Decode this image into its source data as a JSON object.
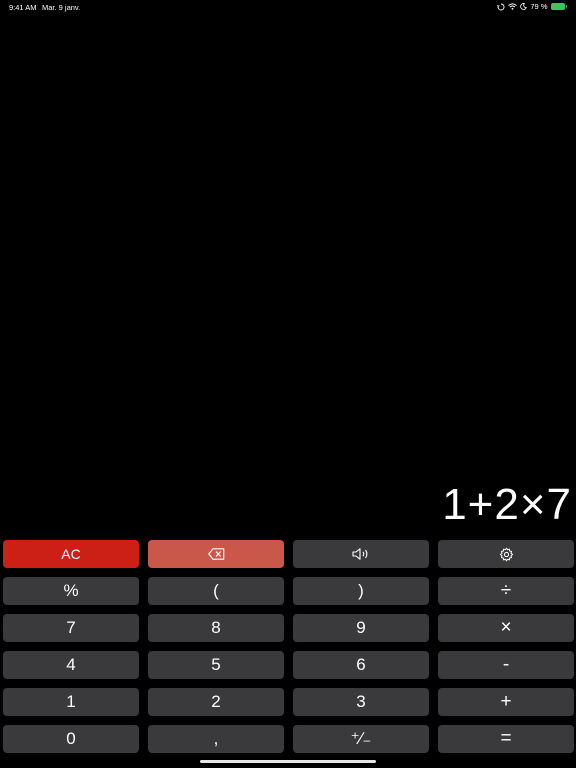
{
  "status_bar": {
    "time": "9:41 AM",
    "date": "Mar. 9 janv.",
    "battery_percent": "79 %",
    "battery_level": 0.79,
    "icons": [
      "rotation-lock-icon",
      "wifi-icon",
      "moon-icon",
      "battery-icon"
    ]
  },
  "display": {
    "expression": "1+2×7"
  },
  "keys": {
    "ac": "AC",
    "backspace_icon": "backspace-icon",
    "sound_icon": "speaker-icon",
    "settings_icon": "gear-icon",
    "percent": "%",
    "paren_open": "(",
    "paren_close": ")",
    "divide": "÷",
    "seven": "7",
    "eight": "8",
    "nine": "9",
    "multiply": "×",
    "four": "4",
    "five": "5",
    "six": "6",
    "minus": "-",
    "one": "1",
    "two": "2",
    "three": "3",
    "plus": "+",
    "zero": "0",
    "comma": ",",
    "plus_minus": "⁺∕₋",
    "equals": "="
  },
  "colors": {
    "background": "#000000",
    "key": "#3a3a3c",
    "ac": "#cc1f16",
    "backspace": "#c9574a",
    "battery": "#3ac45a"
  }
}
